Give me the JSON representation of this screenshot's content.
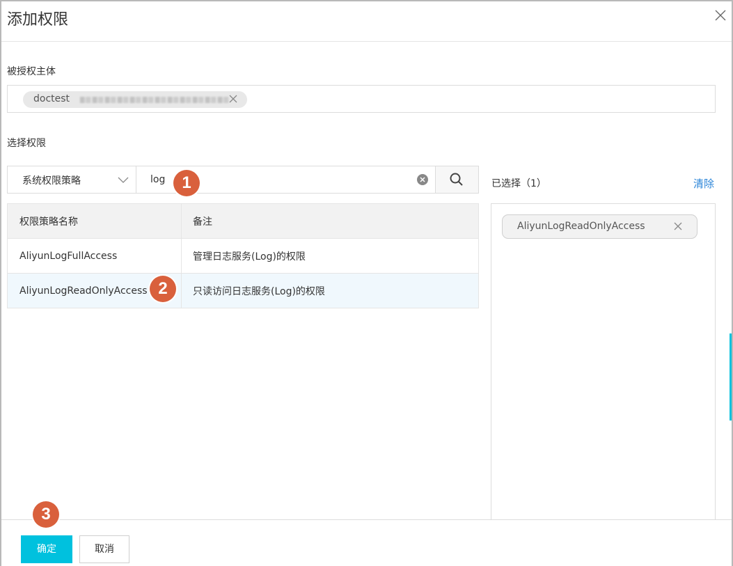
{
  "dialog": {
    "title": "添加权限"
  },
  "principal": {
    "label": "被授权主体",
    "tag_name": "doctest"
  },
  "permissions": {
    "label": "选择权限",
    "policy_type": "系统权限策略",
    "search_value": "log",
    "columns": [
      "权限策略名称",
      "备注"
    ],
    "rows": [
      {
        "name": "AliyunLogFullAccess",
        "note": "管理日志服务(Log)的权限"
      },
      {
        "name": "AliyunLogReadOnlyAccess",
        "note": "只读访问日志服务(Log)的权限"
      }
    ]
  },
  "selected": {
    "label": "已选择（1）",
    "clear_label": "清除",
    "items": [
      "AliyunLogReadOnlyAccess"
    ]
  },
  "footer": {
    "confirm_label": "确定",
    "cancel_label": "取消"
  },
  "steps": [
    "1",
    "2",
    "3"
  ],
  "colors": {
    "accent": "#00c1de",
    "link": "#2a84d8",
    "step_badge": "#d9603c",
    "selected_row": "#f0f8fd"
  }
}
